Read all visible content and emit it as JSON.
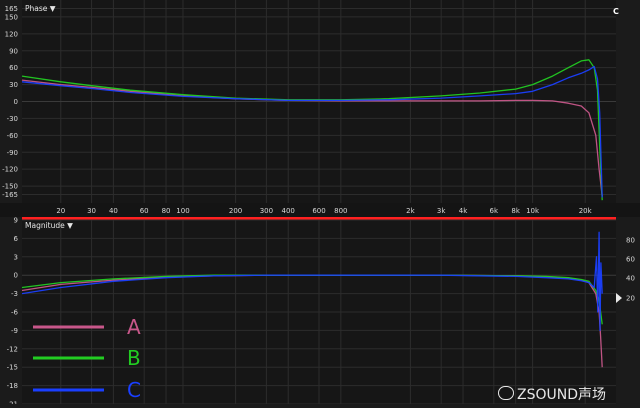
{
  "phase_panel": {
    "title": "Phase ▼",
    "marker": "C"
  },
  "magnitude_panel": {
    "title": "Magnitude ▼"
  },
  "watermark": {
    "text": "ZSOUND声场"
  },
  "colors": {
    "A": "#c8578a",
    "B": "#22cc22",
    "C": "#1a3fff",
    "background": "#1b1b1b",
    "grid": "#2c2c2c",
    "text": "#dcdcdc",
    "accent": "#ff2020"
  },
  "chart_data": [
    {
      "type": "line",
      "title": "Phase",
      "xscale": "log",
      "xlim": [
        12,
        30000
      ],
      "ylim": [
        -180,
        180
      ],
      "x_ticks": [
        20,
        30,
        40,
        60,
        80,
        100,
        200,
        300,
        400,
        600,
        800,
        2000,
        3000,
        4000,
        6000,
        8000,
        10000,
        20000
      ],
      "x_tick_labels": [
        "20",
        "30",
        "40",
        "60",
        "80",
        "100",
        "200",
        "300",
        "400",
        "600",
        "800",
        "2k",
        "3k",
        "4k",
        "6k",
        "8k",
        "10k",
        "20k"
      ],
      "y_ticks": [
        165,
        150,
        120,
        90,
        60,
        30,
        0,
        -30,
        -60,
        -90,
        -120,
        -150,
        -165
      ],
      "y_tick_labels": [
        "165",
        "150",
        "120",
        "90",
        "60",
        "30",
        "0",
        "-30",
        "-60",
        "-90",
        "-120",
        "-150",
        "-165"
      ],
      "series": [
        {
          "name": "A",
          "color": "#c8578a",
          "x": [
            12,
            20,
            30,
            50,
            100,
            200,
            400,
            800,
            1500,
            3000,
            5000,
            8000,
            10000,
            13000,
            16000,
            19000,
            21000,
            23000,
            24000,
            25000
          ],
          "y": [
            38,
            30,
            25,
            18,
            10,
            5,
            2,
            1,
            1,
            1,
            1,
            2,
            2,
            1,
            -3,
            -8,
            -20,
            -60,
            -120,
            -168
          ]
        },
        {
          "name": "B",
          "color": "#22cc22",
          "x": [
            12,
            20,
            30,
            50,
            100,
            200,
            400,
            800,
            1500,
            3000,
            5000,
            8000,
            10000,
            13000,
            16000,
            19000,
            21000,
            22500,
            23500,
            24200,
            25000
          ],
          "y": [
            45,
            35,
            28,
            20,
            12,
            6,
            3,
            3,
            5,
            10,
            15,
            22,
            30,
            45,
            60,
            72,
            74,
            60,
            20,
            -80,
            -175
          ]
        },
        {
          "name": "C",
          "color": "#1a3fff",
          "x": [
            12,
            20,
            30,
            50,
            100,
            200,
            400,
            800,
            1500,
            3000,
            5000,
            8000,
            10000,
            13000,
            16000,
            19000,
            21000,
            22500,
            23500,
            24200,
            25000
          ],
          "y": [
            35,
            28,
            23,
            16,
            9,
            5,
            2,
            2,
            3,
            6,
            10,
            14,
            18,
            30,
            42,
            50,
            56,
            62,
            40,
            -20,
            -170
          ]
        }
      ]
    },
    {
      "type": "line",
      "title": "Magnitude",
      "xscale": "log",
      "xlim": [
        12,
        30000
      ],
      "ylim": [
        -21,
        9
      ],
      "y_ticks": [
        9,
        6,
        3,
        0,
        -3,
        -6,
        -9,
        -12,
        -15,
        -18,
        -21
      ],
      "y_tick_labels": [
        "9",
        "6",
        "3",
        "0",
        "-3",
        "-6",
        "-9",
        "-12",
        "-15",
        "-18",
        "-21"
      ],
      "right_y_ticks": [
        80,
        60,
        40,
        20
      ],
      "right_y_tick_labels": [
        "80",
        "60",
        "40",
        "20"
      ],
      "series": [
        {
          "name": "A",
          "color": "#c8578a",
          "x": [
            12,
            20,
            40,
            80,
            150,
            300,
            1000,
            3000,
            8000,
            12000,
            16000,
            19000,
            21000,
            23000,
            24000,
            24500,
            25000
          ],
          "y": [
            -2.5,
            -1.5,
            -0.8,
            -0.3,
            -0.1,
            0,
            0,
            0,
            -0.1,
            -0.3,
            -0.5,
            -0.8,
            -1.2,
            -3,
            -6,
            -10,
            -15
          ]
        },
        {
          "name": "B",
          "color": "#22cc22",
          "x": [
            12,
            20,
            40,
            80,
            150,
            300,
            1000,
            3000,
            8000,
            12000,
            16000,
            19000,
            21000,
            23000,
            24000,
            24500,
            25000
          ],
          "y": [
            -2,
            -1.2,
            -0.6,
            -0.2,
            0,
            0,
            0,
            0,
            -0.1,
            -0.2,
            -0.4,
            -0.7,
            -1,
            -2.5,
            -4,
            -6,
            -8
          ]
        },
        {
          "name": "C",
          "color": "#1a3fff",
          "x": [
            12,
            20,
            40,
            80,
            150,
            300,
            1000,
            3000,
            8000,
            12000,
            16000,
            19000,
            21000,
            22500,
            23200,
            23600,
            24000,
            24300,
            24600,
            25000
          ],
          "y": [
            -3,
            -2,
            -1,
            -0.4,
            -0.1,
            0,
            0,
            0,
            -0.2,
            -0.4,
            -0.6,
            -0.9,
            -1.2,
            -2,
            3,
            -6,
            7,
            -9,
            2,
            -3
          ]
        }
      ]
    }
  ]
}
